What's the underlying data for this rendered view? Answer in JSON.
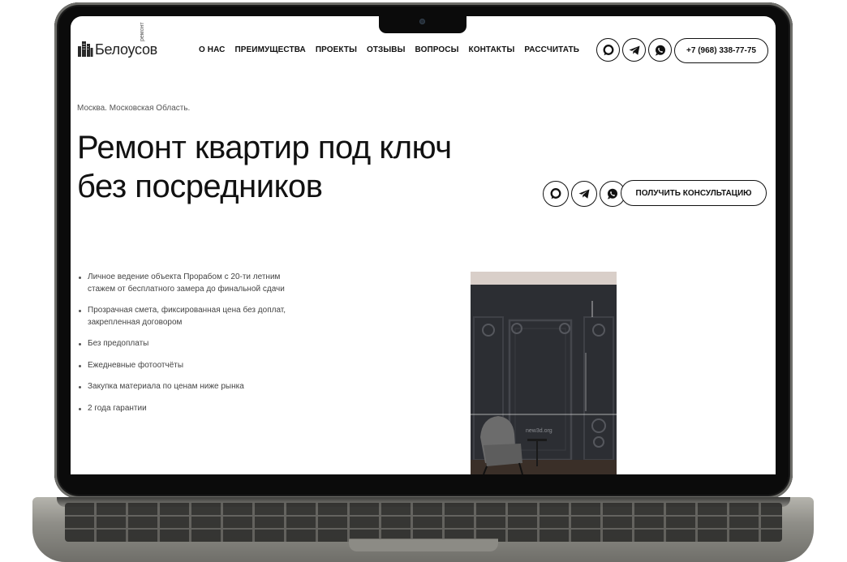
{
  "brand": {
    "name": "Белоусов",
    "tagline": "ремонт"
  },
  "nav": {
    "items": [
      "О НАС",
      "ПРЕИМУЩЕСТВА",
      "ПРОЕКТЫ",
      "ОТЗЫВЫ",
      "ВОПРОСЫ",
      "КОНТАКТЫ",
      "РАССЧИТАТЬ"
    ]
  },
  "header": {
    "phone": "+7 (968) 338-77-75",
    "messengers": [
      "chat-icon",
      "telegram-icon",
      "whatsapp-icon"
    ]
  },
  "hero": {
    "location": "Москва. Московская Область.",
    "title_line1": "Ремонт квартир под ключ",
    "title_line2": "без посредников",
    "cta_label": "ПОЛУЧИТЬ КОНСУЛЬТАЦИЮ"
  },
  "benefits": [
    "Личное ведение объекта Прорабом с 20-ти летним стажем от бесплатного замера до финальной сдачи",
    "Прозрачная смета, фиксированная цена без доплат, закрепленная договором",
    "Без предоплаты",
    "Ежедневные фотоотчёты",
    "Закупка материала по ценам ниже рынка",
    "2 года гарантии"
  ],
  "photo": {
    "watermark": "new3d.org"
  },
  "colors": {
    "text": "#111111",
    "muted": "#555555",
    "laptop_frame": "#0b0b0b",
    "laptop_body": "#a9a8a1"
  }
}
